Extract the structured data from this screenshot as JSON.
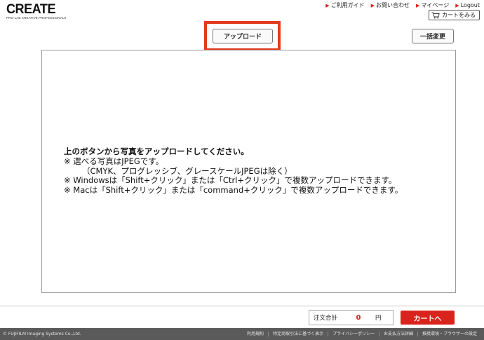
{
  "header": {
    "logo_text": "CREATE",
    "logo_tagline": "PRO-LAB CREATIVE PROFESSIONALS",
    "nav": [
      {
        "label": "ご利用ガイド"
      },
      {
        "label": "お問い合わせ"
      },
      {
        "label": "マイページ"
      },
      {
        "label": "Logout"
      }
    ],
    "cart_label": "カートをみる"
  },
  "toolbar": {
    "upload_label": "アップロード",
    "bulk_change_label": "一括変更",
    "highlight_color": "#e23a1c"
  },
  "instructions": {
    "lead": "上のボタンから写真をアップロードしてください。",
    "line1": "※ 選べる写真はJPEGです。",
    "line2": "（CMYK、プログレッシブ、グレースケールJPEGは除く）",
    "line3": "※ Windowsは「Shift+クリック」または「Ctrl+クリック」で複数アップロードできます。",
    "line4": "※ Macは「Shift+クリック」または「command+クリック」で複数アップロードできます。"
  },
  "order": {
    "total_label": "注文合計",
    "total_value": "0",
    "total_unit": "円",
    "checkout_label": "カートへ",
    "accent_color": "#d9241e"
  },
  "footer": {
    "copyright": "© FUJIFILM Imaging Systems Co.,Ltd.",
    "links": [
      {
        "label": "利用規約"
      },
      {
        "label": "特定商取引法に基づく表示"
      },
      {
        "label": "プライバシーポリシー"
      },
      {
        "label": "お支払方法詳細"
      },
      {
        "label": "推奨環境・ブラウザーの設定"
      }
    ]
  }
}
